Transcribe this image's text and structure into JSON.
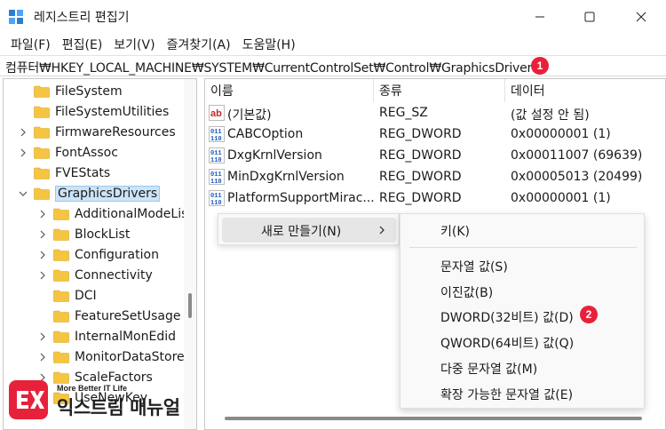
{
  "window": {
    "title": "레지스트리 편집기"
  },
  "menu": [
    "파일(F)",
    "편집(E)",
    "보기(V)",
    "즐겨찾기(A)",
    "도움말(H)"
  ],
  "address": {
    "path": "컴퓨터₩HKEY_LOCAL_MACHINE₩SYSTEM₩CurrentControlSet₩Control₩GraphicsDrivers",
    "badge": "1"
  },
  "tree": {
    "items": [
      {
        "label": "FileSystem",
        "level": 1,
        "expander": "none"
      },
      {
        "label": "FileSystemUtilities",
        "level": 1,
        "expander": "none"
      },
      {
        "label": "FirmwareResources",
        "level": 1,
        "expander": "collapsed"
      },
      {
        "label": "FontAssoc",
        "level": 1,
        "expander": "collapsed"
      },
      {
        "label": "FVEStats",
        "level": 1,
        "expander": "none"
      },
      {
        "label": "GraphicsDrivers",
        "level": 1,
        "expander": "expanded",
        "selected": true
      },
      {
        "label": "AdditionalModeLists",
        "level": 2,
        "expander": "collapsed"
      },
      {
        "label": "BlockList",
        "level": 2,
        "expander": "collapsed"
      },
      {
        "label": "Configuration",
        "level": 2,
        "expander": "collapsed"
      },
      {
        "label": "Connectivity",
        "level": 2,
        "expander": "collapsed"
      },
      {
        "label": "DCI",
        "level": 2,
        "expander": "none"
      },
      {
        "label": "FeatureSetUsage",
        "level": 2,
        "expander": "none"
      },
      {
        "label": "InternalMonEdid",
        "level": 2,
        "expander": "collapsed"
      },
      {
        "label": "MonitorDataStore",
        "level": 2,
        "expander": "collapsed"
      },
      {
        "label": "ScaleFactors",
        "level": 2,
        "expander": "collapsed"
      },
      {
        "label": "UseNewKey",
        "level": 2,
        "expander": "none"
      }
    ]
  },
  "values": {
    "headers": {
      "name": "이름",
      "type": "종류",
      "data": "데이터"
    },
    "rows": [
      {
        "icon": "string-value-icon",
        "name": "(기본값)",
        "type": "REG_SZ",
        "data": "(값 설정 안 됨)"
      },
      {
        "icon": "binary-value-icon",
        "name": "CABCOption",
        "type": "REG_DWORD",
        "data": "0x00000001 (1)"
      },
      {
        "icon": "binary-value-icon",
        "name": "DxgKrnlVersion",
        "type": "REG_DWORD",
        "data": "0x00011007 (69639)"
      },
      {
        "icon": "binary-value-icon",
        "name": "MinDxgKrnlVersion",
        "type": "REG_DWORD",
        "data": "0x00005013 (20499)"
      },
      {
        "icon": "binary-value-icon",
        "name": "PlatformSupportMirac...",
        "type": "REG_DWORD",
        "data": "0x00000001 (1)"
      }
    ]
  },
  "context_menu": {
    "new_label": "새로 만들기(N)"
  },
  "submenu": {
    "items": [
      "키(K)",
      "문자열 값(S)",
      "이진값(B)",
      "DWORD(32비트) 값(D)",
      "QWORD(64비트) 값(Q)",
      "다중 문자열 값(M)",
      "확장 가능한 문자열 값(E)"
    ],
    "badge": "2"
  },
  "watermark": {
    "small": "More Better IT Life",
    "big": "익스트림 매뉴얼"
  },
  "colors": {
    "badge": "#e8213b",
    "selection": "#cce4f7",
    "folder": "#f5c542"
  }
}
